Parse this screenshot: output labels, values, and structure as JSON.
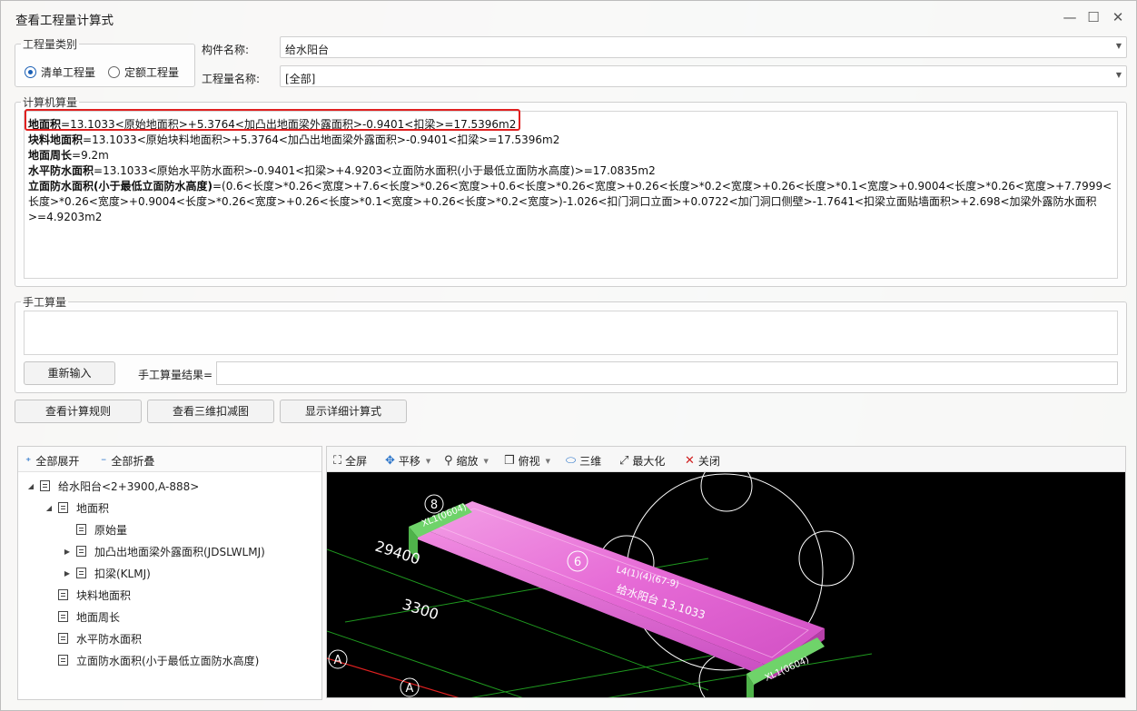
{
  "window": {
    "title": "查看工程量计算式",
    "minimize_icon": "minimize-icon",
    "maximize_icon": "maximize-icon",
    "close_icon": "close-icon"
  },
  "category": {
    "legend": "工程量类别",
    "options": [
      {
        "label": "清单工程量",
        "selected": true
      },
      {
        "label": "定额工程量",
        "selected": false
      }
    ]
  },
  "component": {
    "label": "构件名称:",
    "value": "给水阳台"
  },
  "quantity_name": {
    "label": "工程量名称:",
    "value": "[全部]"
  },
  "computer_calc": {
    "legend": "计算机算量",
    "lines": [
      {
        "name": "地面积",
        "formula": "=13.1033<原始地面积>+5.3764<加凸出地面梁外露面积>-0.9401<扣梁>=17.5396m2"
      },
      {
        "name": "块料地面积",
        "formula": "=13.1033<原始块料地面积>+5.3764<加凸出地面梁外露面积>-0.9401<扣梁>=17.5396m2"
      },
      {
        "name": "地面周长",
        "formula": "=9.2m"
      },
      {
        "name": "水平防水面积",
        "formula": "=13.1033<原始水平防水面积>-0.9401<扣梁>+4.9203<立面防水面积(小于最低立面防水高度)>=17.0835m2"
      },
      {
        "name": "立面防水面积(小于最低立面防水高度)",
        "formula": "=(0.6<长度>*0.26<宽度>+7.6<长度>*0.26<宽度>+0.6<长度>*0.26<宽度>+0.26<长度>*0.2<宽度>+0.26<长度>*0.1<宽度>+0.9004<长度>*0.26<宽度>+7.7999<长度>*0.26<宽度>+0.9004<长度>*0.26<宽度>+0.26<长度>*0.1<宽度>+0.26<长度>*0.2<宽度>)-1.026<扣门洞口立面>+0.0722<加门洞口侧壁>-1.7641<扣梁立面贴墙面积>+2.698<加梁外露防水面积>=4.9203m2"
      }
    ]
  },
  "manual_calc": {
    "legend": "手工算量",
    "reenter_button": "重新输入",
    "result_label": "手工算量结果=",
    "result_value": ""
  },
  "actions": {
    "view_rules": "查看计算规则",
    "view_3d": "查看三维扣减图",
    "show_detail": "显示详细计算式"
  },
  "tree": {
    "expand_all": "全部展开",
    "collapse_all": "全部折叠",
    "nodes": [
      {
        "label": "给水阳台<2+3900,A-888>",
        "level": 0,
        "toggle": "expanded"
      },
      {
        "label": "地面积",
        "level": 1,
        "toggle": "expanded"
      },
      {
        "label": "原始量",
        "level": 2,
        "toggle": "none"
      },
      {
        "label": "加凸出地面梁外露面积(JDSLWLMJ)",
        "level": 2,
        "toggle": "collapsed"
      },
      {
        "label": "扣梁(KLMJ)",
        "level": 2,
        "toggle": "collapsed"
      },
      {
        "label": "块料地面积",
        "level": 1,
        "toggle": "none"
      },
      {
        "label": "地面周长",
        "level": 1,
        "toggle": "none"
      },
      {
        "label": "水平防水面积",
        "level": 1,
        "toggle": "none"
      },
      {
        "label": "立面防水面积(小于最低立面防水高度)",
        "level": 1,
        "toggle": "none"
      }
    ]
  },
  "viewer": {
    "toolbar": {
      "fullscreen": "全屏",
      "pan": "平移",
      "zoom": "缩放",
      "topview": "俯视",
      "threed": "三维",
      "maximize": "最大化",
      "close": "关闭"
    },
    "scene_labels": {
      "dim_long": "29400",
      "dim_short": "3300",
      "axis_8": "8",
      "axis_6": "6",
      "axis_a1": "A",
      "axis_a2": "A",
      "beam_left": "XL1(0604)",
      "beam_right": "XL1(0604)",
      "beam_mid": "L4(1)(4)(67-9)",
      "slab_label": "给水阳台 13.1033"
    },
    "colors": {
      "slab": "#e66bd6",
      "beam": "#6fd36a",
      "grid": "#1f9a1f",
      "axis_red": "#e02020"
    }
  }
}
